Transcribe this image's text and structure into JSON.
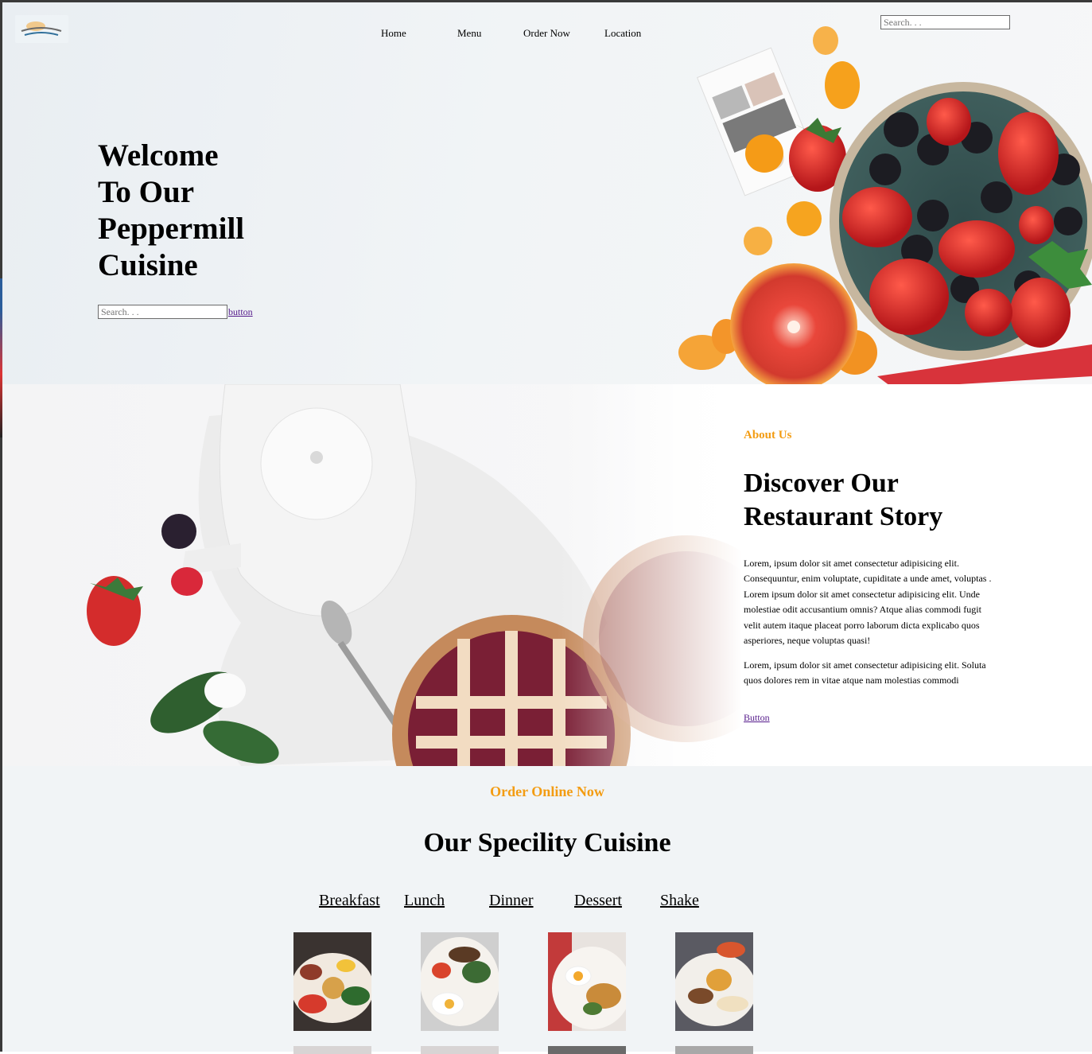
{
  "nav": {
    "items": [
      {
        "label": "Home"
      },
      {
        "label": "Menu"
      },
      {
        "label": "Order Now"
      },
      {
        "label": "Location"
      }
    ],
    "search_placeholder": "Search. . ."
  },
  "hero": {
    "title_lines": [
      "Welcome",
      "To Our",
      "Peppermill",
      "Cuisine"
    ],
    "search_placeholder": "Search. . .",
    "button_label": "button"
  },
  "about": {
    "label": "About Us",
    "title_lines": [
      "Discover Our",
      "Restaurant Story"
    ],
    "paragraph1": "Lorem, ipsum dolor sit amet consectetur adipisicing elit. Consequuntur, enim voluptate, cupiditate a unde amet, voluptas . Lorem ipsum dolor sit amet consectetur adipisicing elit. Unde molestiae odit accusantium omnis? Atque alias commodi fugit velit autem itaque placeat porro laborum dicta explicabo quos asperiores, neque voluptas quasi!",
    "paragraph2": "Lorem, ipsum dolor sit amet consectetur adipisicing elit. Soluta quos dolores rem in vitae atque nam molestias commodi",
    "button_label": "Button"
  },
  "specialty": {
    "eyebrow": "Order Online Now",
    "title": "Our Specility Cuisine",
    "tabs": [
      {
        "label": "Breakfast"
      },
      {
        "label": "Lunch"
      },
      {
        "label": "Dinner"
      },
      {
        "label": "Dessert"
      },
      {
        "label": "Shake"
      }
    ],
    "dish_count": 4
  },
  "colors": {
    "accent": "#f39c12",
    "visited_link": "#551a8b",
    "section_bg": "#f1f4f6"
  }
}
